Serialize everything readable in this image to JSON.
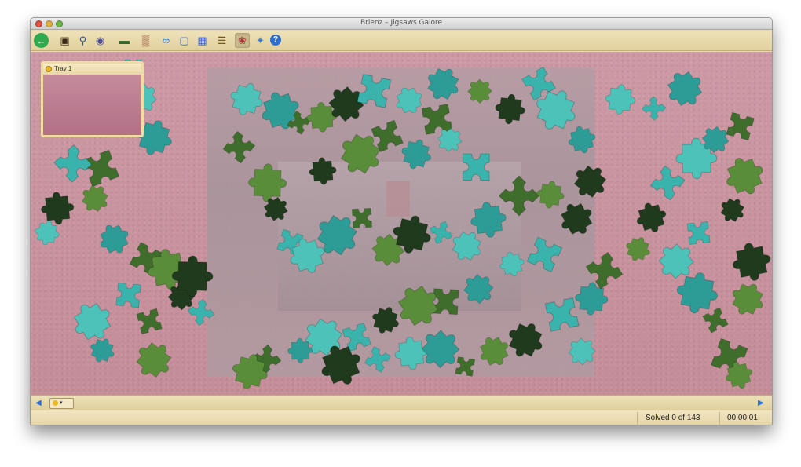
{
  "window": {
    "title": "Brienz – Jigsaws Galore"
  },
  "toolbar": {
    "buttons": [
      {
        "name": "back",
        "glyph": "←"
      },
      {
        "name": "picture",
        "glyph": "▣"
      },
      {
        "name": "zoom",
        "glyph": "⚲"
      },
      {
        "name": "view",
        "glyph": "◉"
      },
      {
        "name": "landscape",
        "glyph": "▬"
      },
      {
        "name": "edge-pieces",
        "glyph": "▒"
      },
      {
        "name": "link",
        "glyph": "∞"
      },
      {
        "name": "frame",
        "glyph": "▢"
      },
      {
        "name": "grid",
        "glyph": "▦"
      },
      {
        "name": "tray",
        "glyph": "☰"
      },
      {
        "name": "ladybug",
        "glyph": "❀"
      },
      {
        "name": "shuffle",
        "glyph": "✦"
      },
      {
        "name": "help",
        "glyph": "?"
      }
    ]
  },
  "tray": {
    "label": "Tray 1"
  },
  "bottombar": {
    "tray_selector": "▾",
    "left_arrow": "◀",
    "right_arrow": "▶"
  },
  "status": {
    "solved": "Solved 0 of 143",
    "timer": "00:00:01"
  },
  "colors": {
    "board": "#c9939f",
    "teal_piece": "#39b3ab",
    "green_piece": "#3f6d2c",
    "dark_piece": "#203a1e",
    "toolbar": "#e9d8a8"
  }
}
